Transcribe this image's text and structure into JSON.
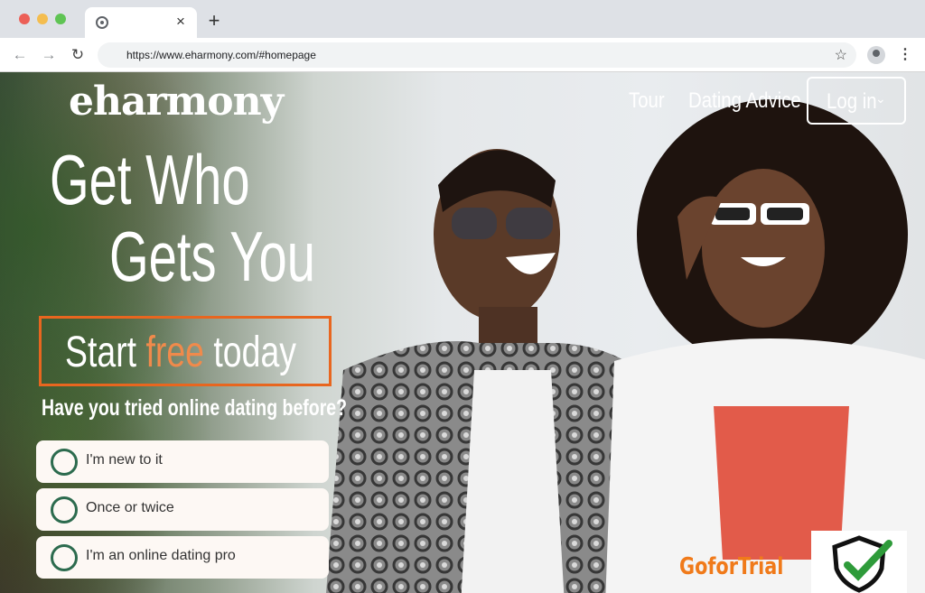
{
  "browser": {
    "tab_close": "×",
    "new_tab": "+",
    "url": "https://www.eharmony.com/#homepage"
  },
  "site": {
    "logo": "eharmony",
    "nav": {
      "tour": "Tour",
      "dating_advice": "Dating Advice",
      "login": "Log in"
    },
    "headline_line1": "Get Who",
    "headline_line2": "Gets You",
    "cta_start": "Start",
    "cta_free": "free",
    "cta_today": "today",
    "question": "Have you tried online dating before?",
    "options": [
      {
        "label": "I'm new to it"
      },
      {
        "label": "Once or twice"
      },
      {
        "label": "I'm an online dating pro"
      }
    ]
  },
  "overlay": {
    "watermark": "GoforTrial"
  },
  "colors": {
    "accent_orange": "#e8661f",
    "radio_green": "#2c6b4e",
    "shield_green": "#2e9b3a"
  }
}
